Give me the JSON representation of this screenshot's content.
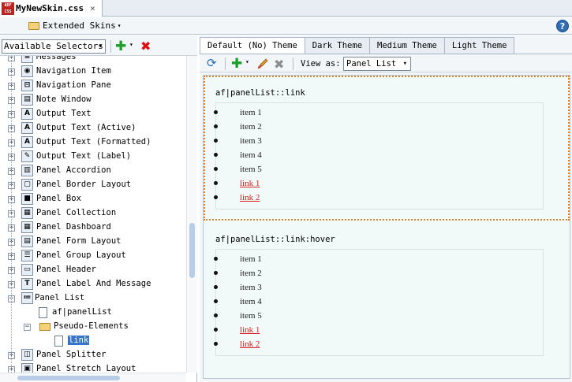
{
  "window": {
    "file_tab_label": "MyNewSkin.css",
    "file_icon_text": "ADF CSS",
    "close_glyph": "×"
  },
  "toolbar": {
    "extends_label": "Extended Skins",
    "caret": "▾",
    "help_glyph": "?"
  },
  "left": {
    "selector_dropdown": "Available Selectors",
    "dd_caret": "▾",
    "add_glyph": "✚",
    "add_caret": "▾",
    "delete_glyph": "✖",
    "tree": [
      {
        "label": "Messages",
        "icon": "messages-icon",
        "glyph": "≡",
        "expander": "+"
      },
      {
        "label": "Navigation Item",
        "icon": "navigation-item-icon",
        "glyph": "◉",
        "expander": "+"
      },
      {
        "label": "Navigation Pane",
        "icon": "navigation-pane-icon",
        "glyph": "⊟",
        "expander": "+"
      },
      {
        "label": "Note Window",
        "icon": "note-window-icon",
        "glyph": "▤",
        "expander": "+"
      },
      {
        "label": "Output Text",
        "icon": "output-text-icon",
        "glyph": "A",
        "expander": "+"
      },
      {
        "label": "Output Text (Active)",
        "icon": "output-text-active-icon",
        "glyph": "A",
        "expander": "+"
      },
      {
        "label": "Output Text (Formatted)",
        "icon": "output-text-formatted-icon",
        "glyph": "A",
        "expander": "+"
      },
      {
        "label": "Output Text (Label)",
        "icon": "output-text-label-icon",
        "glyph": "✎",
        "expander": "+"
      },
      {
        "label": "Panel Accordion",
        "icon": "panel-accordion-icon",
        "glyph": "▥",
        "expander": "+"
      },
      {
        "label": "Panel Border Layout",
        "icon": "panel-border-layout-icon",
        "glyph": "▢",
        "expander": "+"
      },
      {
        "label": "Panel Box",
        "icon": "panel-box-icon",
        "glyph": "■",
        "expander": "+"
      },
      {
        "label": "Panel Collection",
        "icon": "panel-collection-icon",
        "glyph": "▦",
        "expander": "+"
      },
      {
        "label": "Panel Dashboard",
        "icon": "panel-dashboard-icon",
        "glyph": "▦",
        "expander": "+"
      },
      {
        "label": "Panel Form Layout",
        "icon": "panel-form-layout-icon",
        "glyph": "▤",
        "expander": "+"
      },
      {
        "label": "Panel Group Layout",
        "icon": "panel-group-layout-icon",
        "glyph": "☰",
        "expander": "+"
      },
      {
        "label": "Panel Header",
        "icon": "panel-header-icon",
        "glyph": "▭",
        "expander": "+"
      },
      {
        "label": "Panel Label And Message",
        "icon": "panel-label-message-icon",
        "glyph": "T",
        "expander": "+"
      },
      {
        "label": "Panel List",
        "icon": "panel-list-icon",
        "glyph": "≔",
        "expander": "−"
      },
      {
        "label": "af|panelList",
        "icon": "file-icon",
        "glyph": "",
        "expander": ""
      },
      {
        "label": "Pseudo-Elements",
        "icon": "folder-open-icon",
        "glyph": "",
        "expander": "−"
      },
      {
        "label": "link",
        "icon": "file-icon",
        "glyph": "",
        "expander": ""
      },
      {
        "label": "Panel Splitter",
        "icon": "panel-splitter-icon",
        "glyph": "◫",
        "expander": "+"
      },
      {
        "label": "Panel Stretch Layout",
        "icon": "panel-stretch-layout-icon",
        "glyph": "▣",
        "expander": "+"
      }
    ]
  },
  "right": {
    "tabs": [
      "Default (No) Theme",
      "Dark Theme",
      "Medium Theme",
      "Light Theme"
    ],
    "refresh_glyph": "⟳",
    "add_glyph": "✚",
    "add_caret": "▾",
    "clear_glyph": "✖",
    "view_as_label": "View as:",
    "view_as_value": "Panel List",
    "dd_caret": "▾",
    "sections": [
      {
        "title": "af|panelList::link",
        "items": [
          "item 1",
          "item 2",
          "item 3",
          "item 4",
          "item 5"
        ],
        "links": [
          "link 1",
          "link 2"
        ]
      },
      {
        "title": "af|panelList::link:hover",
        "items": [
          "item 1",
          "item 2",
          "item 3",
          "item 4",
          "item 5"
        ],
        "links": [
          "link 1",
          "link 2"
        ]
      }
    ]
  },
  "colors": {
    "accent": "#3874c9",
    "link_red": "#d42020",
    "selection_outline": "#e0802a",
    "add_green": "#1e9e2a",
    "delete_red": "#d11"
  }
}
